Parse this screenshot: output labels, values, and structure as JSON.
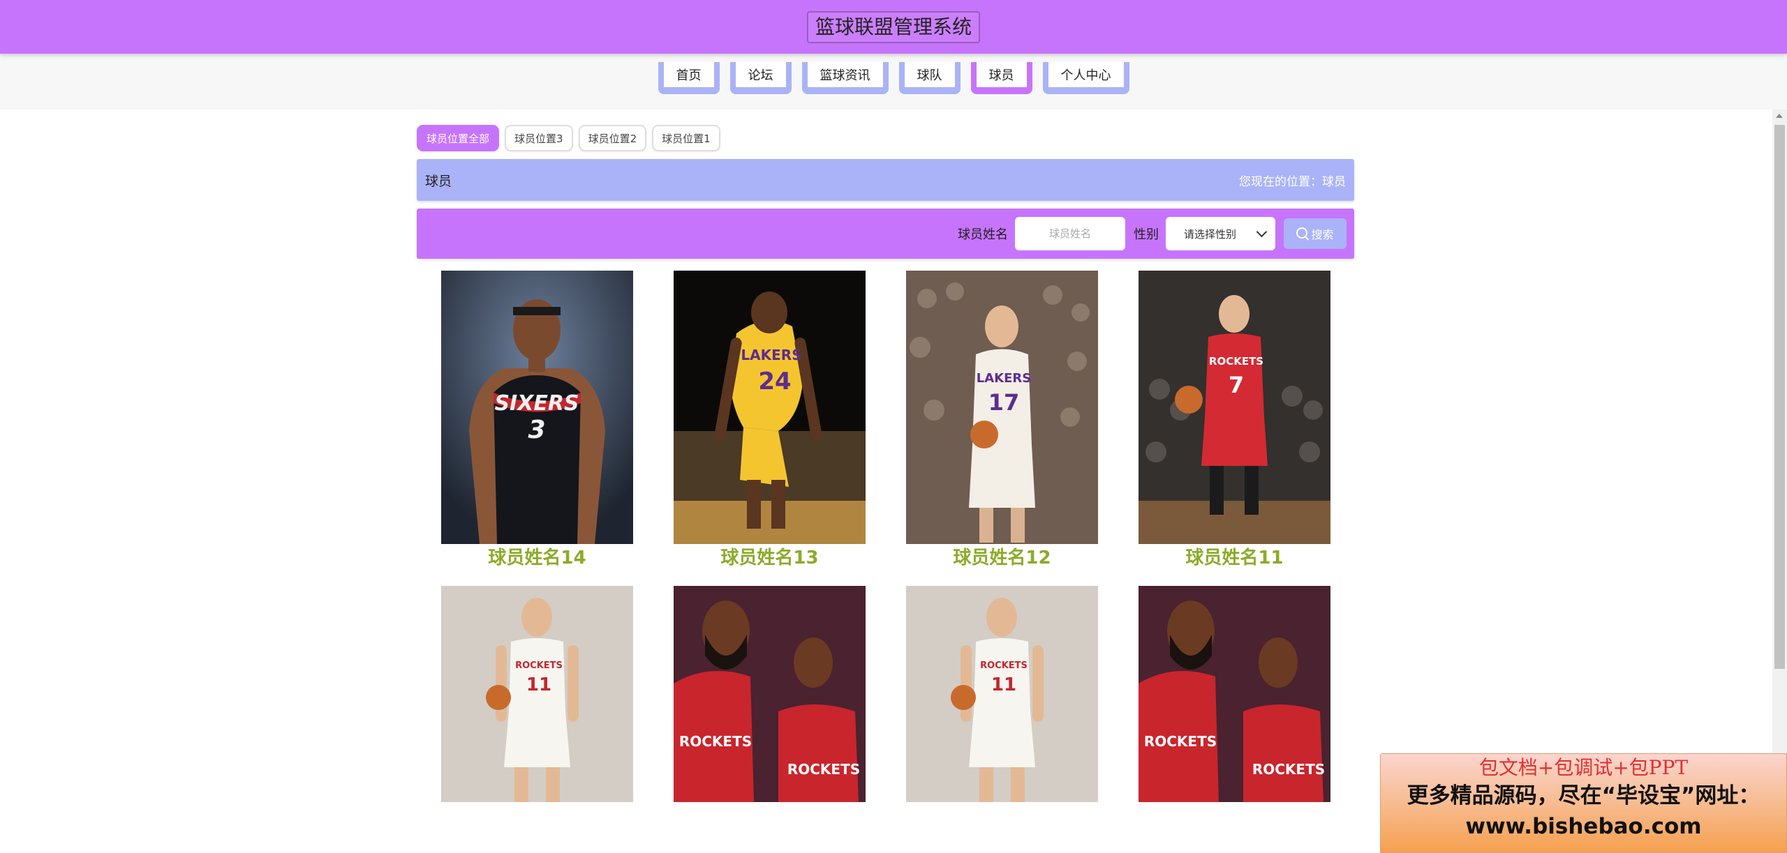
{
  "header": {
    "title": "篮球联盟管理系统"
  },
  "nav": {
    "items": [
      {
        "label": "首页"
      },
      {
        "label": "论坛"
      },
      {
        "label": "篮球资讯"
      },
      {
        "label": "球队"
      },
      {
        "label": "球员",
        "active": true
      },
      {
        "label": "个人中心"
      }
    ]
  },
  "filters": {
    "items": [
      {
        "label": "球员位置全部",
        "active": true
      },
      {
        "label": "球员位置3"
      },
      {
        "label": "球员位置2"
      },
      {
        "label": "球员位置1"
      }
    ]
  },
  "breadcrumb": {
    "title": "球员",
    "location": "您现在的位置：球员"
  },
  "search": {
    "name_label": "球员姓名",
    "name_placeholder": "球员姓名",
    "gender_label": "性别",
    "gender_selected": "请选择性别",
    "button_label": "搜索"
  },
  "players": [
    {
      "name": "球员姓名14"
    },
    {
      "name": "球员姓名13"
    },
    {
      "name": "球员姓名12"
    },
    {
      "name": "球员姓名11"
    },
    {
      "name": ""
    },
    {
      "name": ""
    },
    {
      "name": ""
    },
    {
      "name": ""
    }
  ],
  "ad": {
    "line1": "包文档+包调试+包PPT",
    "line2": "更多精品源码，尽在“毕设宝”网址：",
    "line3": "www.bishebao.com"
  },
  "colors": {
    "header": "#c774fc",
    "nav_tab": "#aab3f7",
    "accent": "#c774fc",
    "player_name": "#8cab2a"
  },
  "icons": {
    "search": "magnifier-icon",
    "select": "chevron-down-icon"
  }
}
